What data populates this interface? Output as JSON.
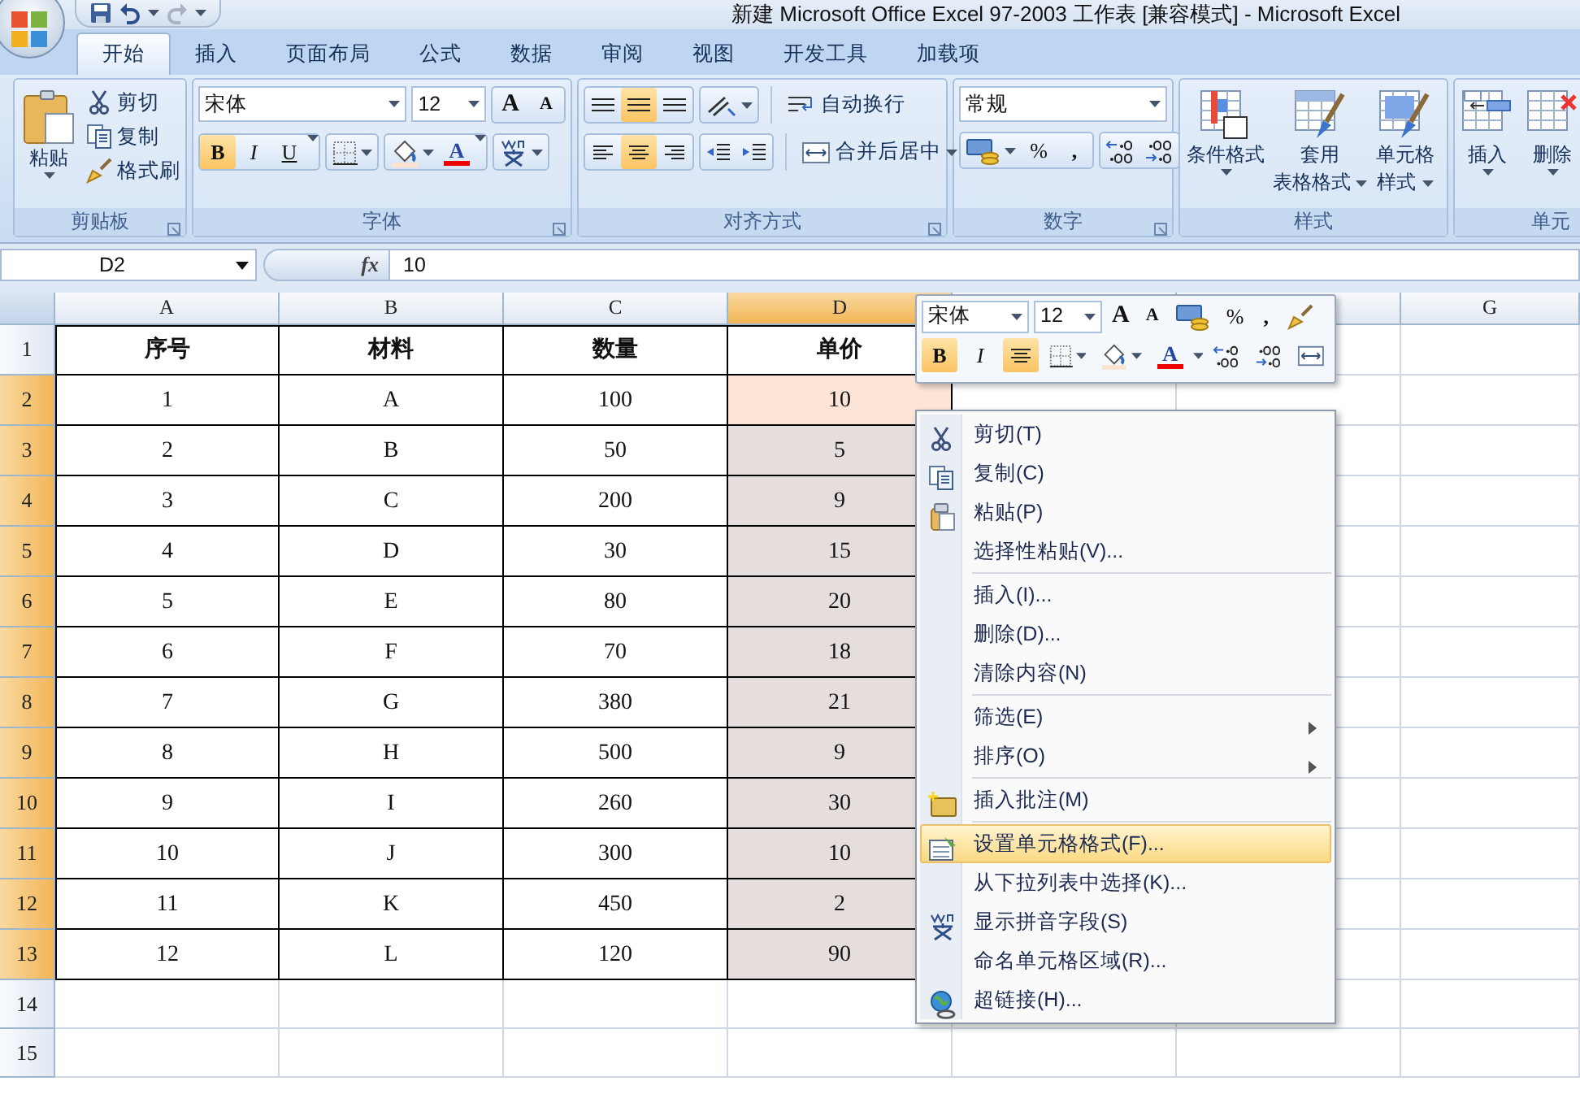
{
  "window": {
    "title": "新建 Microsoft Office Excel 97-2003 工作表  [兼容模式] - Microsoft Excel"
  },
  "tabs": [
    {
      "label": "开始",
      "selected": true
    },
    {
      "label": "插入",
      "selected": false
    },
    {
      "label": "页面布局",
      "selected": false
    },
    {
      "label": "公式",
      "selected": false
    },
    {
      "label": "数据",
      "selected": false
    },
    {
      "label": "审阅",
      "selected": false
    },
    {
      "label": "视图",
      "selected": false
    },
    {
      "label": "开发工具",
      "selected": false
    },
    {
      "label": "加载项",
      "selected": false
    }
  ],
  "ribbon": {
    "clipboard": {
      "title": "剪贴板",
      "paste": "粘贴",
      "actions": [
        "剪切",
        "复制",
        "格式刷"
      ]
    },
    "font": {
      "title": "字体",
      "font_name": "宋体",
      "font_size": "12",
      "grow": "A",
      "shrink": "A",
      "color_label": "A",
      "styles": [
        {
          "label": "B",
          "selected": true
        },
        {
          "label": "I",
          "selected": false
        },
        {
          "label": "U",
          "selected": false
        }
      ]
    },
    "alignment": {
      "title": "对齐方式",
      "vertical": [
        {
          "selected": false
        },
        {
          "selected": true
        },
        {
          "selected": false
        }
      ],
      "horizontal": [
        {
          "selected": false
        },
        {
          "selected": true
        },
        {
          "selected": false
        }
      ],
      "wrap": "自动换行",
      "merge": "合并后居中"
    },
    "number": {
      "title": "数字",
      "format": "常规",
      "percent": "%",
      "comma": ","
    },
    "styles": {
      "title": "样式",
      "buttons": [
        {
          "lines": [
            "条件格式"
          ]
        },
        {
          "lines": [
            "套用",
            "表格格式"
          ]
        },
        {
          "lines": [
            "单元格",
            "样式"
          ]
        }
      ]
    },
    "cells": {
      "title": "单元",
      "buttons": [
        {
          "lines": [
            "插入"
          ]
        },
        {
          "lines": [
            "删除"
          ]
        }
      ]
    }
  },
  "formula_bar": {
    "name_box": "D2",
    "fx": "fx",
    "value": "10"
  },
  "sheet": {
    "columns": [
      {
        "label": "A",
        "selected": false
      },
      {
        "label": "B",
        "selected": false
      },
      {
        "label": "C",
        "selected": false
      },
      {
        "label": "D",
        "selected": true
      },
      {
        "selected": false
      },
      {
        "selected": false
      },
      {
        "label": "G",
        "selected": false
      }
    ],
    "rows": [
      {
        "header": "1",
        "kind": "header",
        "selected": false,
        "active": false,
        "cells": [
          "序号",
          "材料",
          "数量",
          "单价"
        ]
      },
      {
        "header": "2",
        "kind": "data",
        "selected": true,
        "active": true,
        "cells": [
          "1",
          "A",
          "100",
          "10"
        ]
      },
      {
        "header": "3",
        "kind": "data",
        "selected": true,
        "active": false,
        "cells": [
          "2",
          "B",
          "50",
          "5"
        ]
      },
      {
        "header": "4",
        "kind": "data",
        "selected": true,
        "active": false,
        "cells": [
          "3",
          "C",
          "200",
          "9"
        ]
      },
      {
        "header": "5",
        "kind": "data",
        "selected": true,
        "active": false,
        "cells": [
          "4",
          "D",
          "30",
          "15"
        ]
      },
      {
        "header": "6",
        "kind": "data",
        "selected": true,
        "active": false,
        "cells": [
          "5",
          "E",
          "80",
          "20"
        ]
      },
      {
        "header": "7",
        "kind": "data",
        "selected": true,
        "active": false,
        "cells": [
          "6",
          "F",
          "70",
          "18"
        ]
      },
      {
        "header": "8",
        "kind": "data",
        "selected": true,
        "active": false,
        "cells": [
          "7",
          "G",
          "380",
          "21"
        ]
      },
      {
        "header": "9",
        "kind": "data",
        "selected": true,
        "active": false,
        "cells": [
          "8",
          "H",
          "500",
          "9"
        ]
      },
      {
        "header": "10",
        "kind": "data",
        "selected": true,
        "active": false,
        "cells": [
          "9",
          "I",
          "260",
          "30"
        ]
      },
      {
        "header": "11",
        "kind": "data",
        "selected": true,
        "active": false,
        "cells": [
          "10",
          "J",
          "300",
          "10"
        ]
      },
      {
        "header": "12",
        "kind": "data",
        "selected": true,
        "active": false,
        "cells": [
          "11",
          "K",
          "450",
          "2"
        ]
      },
      {
        "header": "13",
        "kind": "data",
        "selected": true,
        "active": false,
        "cells": [
          "12",
          "L",
          "120",
          "90"
        ]
      },
      {
        "header": "14",
        "kind": "empty",
        "selected": false,
        "active": false
      },
      {
        "header": "15",
        "kind": "empty",
        "selected": false,
        "active": false
      }
    ]
  },
  "mini_toolbar": {
    "font_name": "宋体",
    "font_size": "12",
    "grow": "A",
    "shrink": "A",
    "percent": "%",
    "comma": ",",
    "color_label": "A",
    "bold": {
      "label": "B",
      "selected": true
    },
    "italic": {
      "label": "I",
      "selected": false
    },
    "center": {
      "selected": true
    }
  },
  "context_menu": {
    "items": [
      {
        "kind": "item",
        "label": "剪切(T)",
        "submenu": false,
        "selected": false
      },
      {
        "kind": "item",
        "label": "复制(C)",
        "submenu": false,
        "selected": false
      },
      {
        "kind": "item",
        "label": "粘贴(P)",
        "submenu": false,
        "selected": false
      },
      {
        "kind": "item",
        "label": "选择性粘贴(V)...",
        "submenu": false,
        "selected": false
      },
      {
        "kind": "separator"
      },
      {
        "kind": "item",
        "label": "插入(I)...",
        "submenu": false,
        "selected": false
      },
      {
        "kind": "item",
        "label": "删除(D)...",
        "submenu": false,
        "selected": false
      },
      {
        "kind": "item",
        "label": "清除内容(N)",
        "submenu": false,
        "selected": false
      },
      {
        "kind": "separator"
      },
      {
        "kind": "item",
        "label": "筛选(E)",
        "submenu": true,
        "selected": false
      },
      {
        "kind": "item",
        "label": "排序(O)",
        "submenu": true,
        "selected": false
      },
      {
        "kind": "separator"
      },
      {
        "kind": "item",
        "label": "插入批注(M)",
        "submenu": false,
        "selected": false
      },
      {
        "kind": "separator"
      },
      {
        "kind": "item",
        "label": "设置单元格格式(F)...",
        "submenu": false,
        "selected": true
      },
      {
        "kind": "item",
        "label": "从下拉列表中选择(K)...",
        "submenu": false,
        "selected": false
      },
      {
        "kind": "item",
        "label": "显示拼音字段(S)",
        "submenu": false,
        "selected": false
      },
      {
        "kind": "item",
        "label": "命名单元格区域(R)...",
        "submenu": false,
        "selected": false
      },
      {
        "kind": "item",
        "label": "超链接(H)...",
        "submenu": false,
        "selected": false
      }
    ]
  }
}
